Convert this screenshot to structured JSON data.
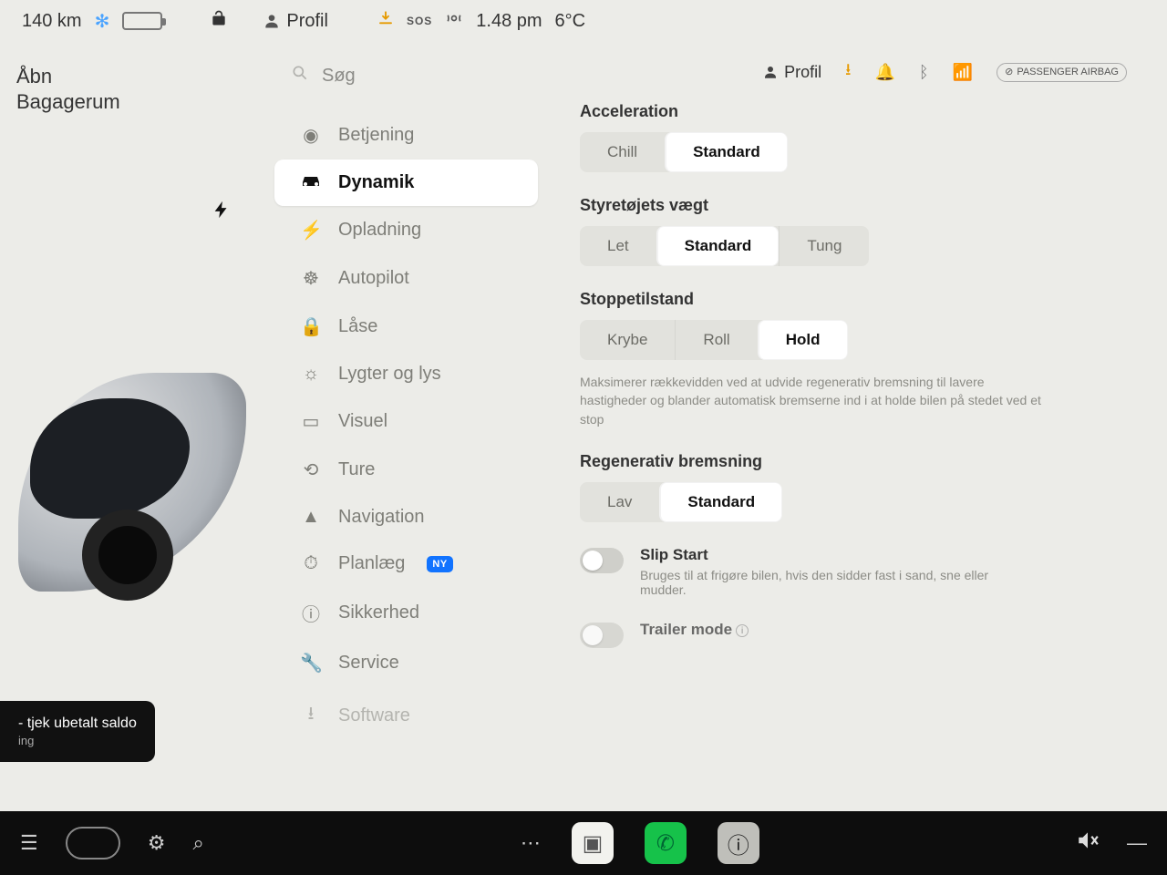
{
  "status": {
    "range": "140 km",
    "profile_label": "Profil",
    "time": "1.48 pm",
    "temp": "6°C",
    "sos": "SOS"
  },
  "car_panel": {
    "open_line1": "Åbn",
    "open_line2": "Bagagerum",
    "notice_title": "- tjek ubetalt saldo",
    "notice_sub": "ing"
  },
  "search": {
    "placeholder": "Søg"
  },
  "sidebar": {
    "items": [
      {
        "id": "betjening",
        "label": "Betjening"
      },
      {
        "id": "dynamik",
        "label": "Dynamik"
      },
      {
        "id": "opladning",
        "label": "Opladning"
      },
      {
        "id": "autopilot",
        "label": "Autopilot"
      },
      {
        "id": "laase",
        "label": "Låse"
      },
      {
        "id": "lygter",
        "label": "Lygter og lys"
      },
      {
        "id": "visuel",
        "label": "Visuel"
      },
      {
        "id": "ture",
        "label": "Ture"
      },
      {
        "id": "navigation",
        "label": "Navigation"
      },
      {
        "id": "planlaeg",
        "label": "Planlæg"
      },
      {
        "id": "sikkerhed",
        "label": "Sikkerhed"
      },
      {
        "id": "service",
        "label": "Service"
      },
      {
        "id": "software",
        "label": "Software"
      }
    ],
    "new_badge": "NY"
  },
  "content": {
    "profile_label": "Profil",
    "airbag_label": "PASSENGER AIRBAG",
    "acceleration": {
      "title": "Acceleration",
      "opts": [
        "Chill",
        "Standard"
      ],
      "selected": 1
    },
    "steering": {
      "title": "Styretøjets vægt",
      "opts": [
        "Let",
        "Standard",
        "Tung"
      ],
      "selected": 1
    },
    "stopping": {
      "title": "Stoppetilstand",
      "opts": [
        "Krybe",
        "Roll",
        "Hold"
      ],
      "selected": 2,
      "desc": "Maksimerer rækkevidden ved at udvide regenerativ bremsning til lavere hastigheder og blander automatisk bremserne ind i at holde bilen på stedet ved et stop"
    },
    "regen": {
      "title": "Regenerativ bremsning",
      "opts": [
        "Lav",
        "Standard"
      ],
      "selected": 1
    },
    "slip": {
      "title": "Slip Start",
      "desc": "Bruges til at frigøre bilen, hvis den sidder fast i sand, sne eller mudder."
    },
    "trailer": {
      "title": "Trailer mode"
    }
  }
}
